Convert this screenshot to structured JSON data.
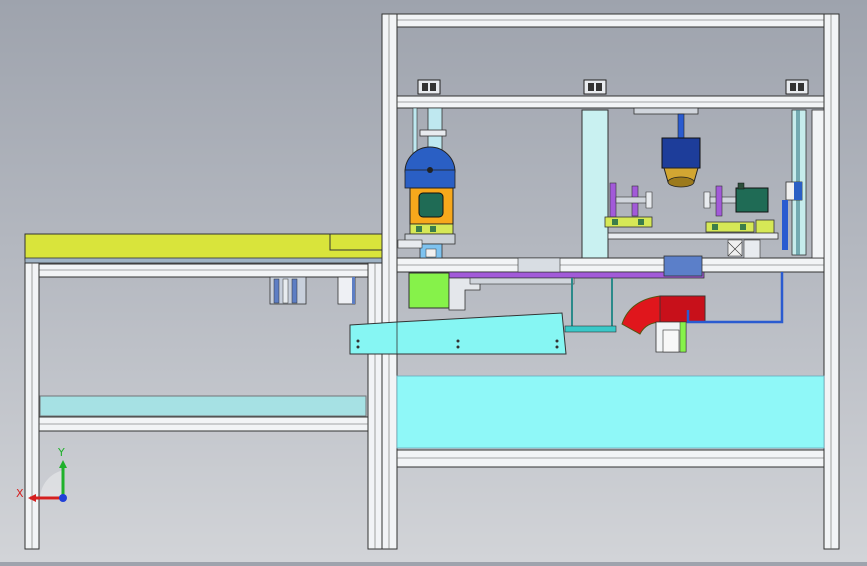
{
  "viewport": {
    "background": "#b3b7bf"
  },
  "colors": {
    "frame_fill": "#f2f4f6",
    "frame_stroke": "#2a2a2a",
    "tabletop": "#d9e43b",
    "cyan_panel": "#8ff8f8",
    "cyan_guard": "#86f6f3",
    "green_block": "#86f24a",
    "purple_bracket": "#a25ad9",
    "blue_tube": "#2a5bd0",
    "red_duct": "#e0161c",
    "motor_orange": "#f7a81c",
    "motor_blue": "#2a5fc4",
    "dark_teal": "#1f6b55",
    "gold_clamp": "#d2a632"
  },
  "triad": {
    "x_label": "X",
    "y_label": "Y",
    "x_color": "#d52020",
    "y_color": "#1fb12b",
    "z_color": "#2040d8"
  }
}
